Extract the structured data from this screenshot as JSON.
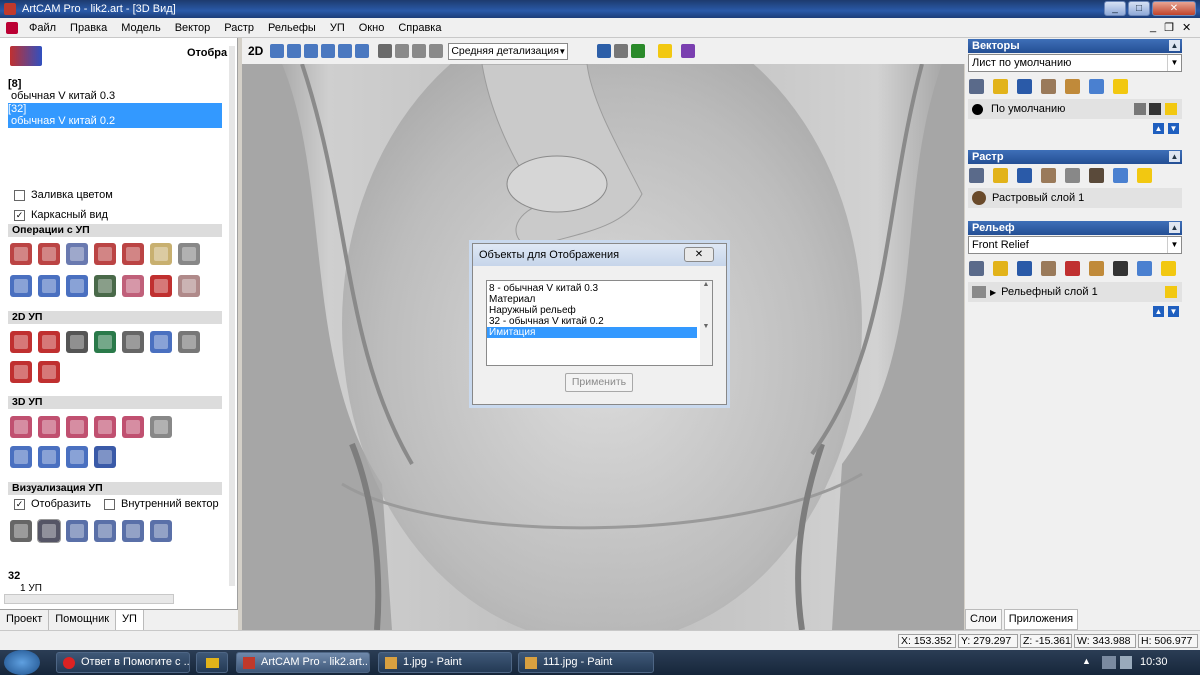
{
  "window": {
    "title": "ArtCAM Pro - lik2.art - [3D Вид]"
  },
  "menu": [
    "Файл",
    "Правка",
    "Модель",
    "Вектор",
    "Растр",
    "Рельефы",
    "УП",
    "Окно",
    "Справка"
  ],
  "toolbar": {
    "mode_2d": "2D",
    "detail_select": "Средняя детализация"
  },
  "left_panel": {
    "header_label": "Отобра",
    "toolpaths": [
      {
        "id": "[8]",
        "name": "обычная V китай 0.3",
        "selected": false
      },
      {
        "id": "[32]",
        "name": "обычная V китай 0.2",
        "selected": true
      }
    ],
    "fill_color": "Заливка цветом",
    "wireframe": "Каркасный вид",
    "sections": {
      "ops": "Операции с УП",
      "two_d": "2D УП",
      "three_d": "3D УП",
      "viz": "Визуализация УП"
    },
    "viz_show": "Отобразить",
    "viz_inner": "Внутренний вектор",
    "bottom_id": "32",
    "bottom_sub": "1 УП",
    "tabs": [
      "Проект",
      "Помощник",
      "УП"
    ]
  },
  "right_panel": {
    "vectors": {
      "title": "Векторы",
      "sheet": "Лист по умолчанию",
      "layer": "По умолчанию"
    },
    "raster": {
      "title": "Растр",
      "layer": "Растровый слой 1"
    },
    "relief": {
      "title": "Рельеф",
      "select": "Front Relief",
      "layer": "Рельефный слой 1"
    },
    "tabs": [
      "Слои",
      "Приложения"
    ]
  },
  "dialog": {
    "title": "Объекты для Отображения",
    "items": [
      {
        "label": "8 - обычная V китай 0.3",
        "selected": false
      },
      {
        "label": "Материал",
        "selected": false
      },
      {
        "label": "Наружный рельеф",
        "selected": false
      },
      {
        "label": "32 - обычная V китай 0.2",
        "selected": false
      },
      {
        "label": "Имитация",
        "selected": true
      }
    ],
    "apply": "Применить"
  },
  "status": {
    "x": "X: 153.352",
    "y": "Y: 279.297",
    "z": "Z: -15.361",
    "w": "W: 343.988",
    "h": "H: 506.977"
  },
  "taskbar": {
    "items": [
      "Ответ в Помогите с ...",
      "",
      "ArtCAM Pro - lik2.art...",
      "1.jpg - Paint",
      "111.jpg - Paint"
    ],
    "clock": "10:30"
  },
  "colors": {
    "selection": "#3399ff",
    "title_blue": "#2a5aa8",
    "panel_title": "#2f5ea6"
  }
}
